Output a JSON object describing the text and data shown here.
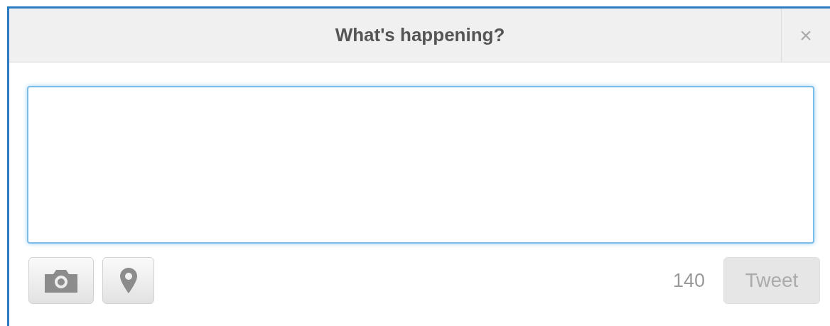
{
  "dialog": {
    "title": "What's happening?",
    "close": "×"
  },
  "composer": {
    "tools": [
      {
        "kind": "camera"
      },
      {
        "kind": "location"
      }
    ],
    "counter": "140",
    "tweet_button": {
      "label": "Tweet",
      "disabled": true
    }
  }
}
